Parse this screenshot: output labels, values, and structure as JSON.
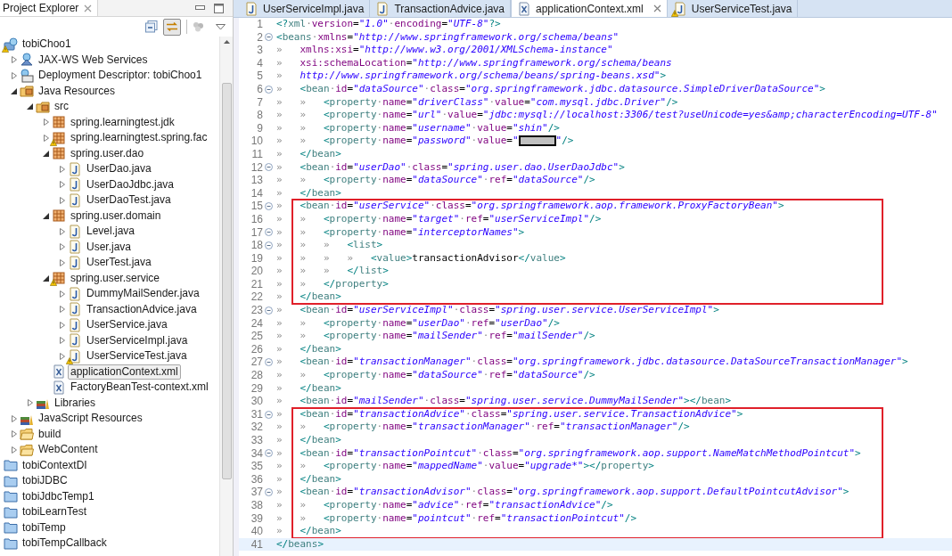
{
  "explorer": {
    "title": "Project Explorer",
    "link_with_editor_on": true,
    "tree": [
      {
        "label": "tobiChoo1",
        "kind": "project",
        "arrow": false,
        "expanded": true,
        "warning": true,
        "selected": false,
        "children": [
          {
            "label": "JAX-WS Web Services",
            "kind": "webservices",
            "arrow": true,
            "expanded": false,
            "warning": false,
            "selected": false
          },
          {
            "label": "Deployment Descriptor: tobiChoo1",
            "kind": "descriptor",
            "arrow": true,
            "expanded": false,
            "warning": false,
            "selected": false
          },
          {
            "label": "Java Resources",
            "kind": "java-resources",
            "arrow": true,
            "expanded": true,
            "warning": false,
            "selected": false,
            "children": [
              {
                "label": "src",
                "kind": "source-folder",
                "arrow": true,
                "expanded": true,
                "warning": false,
                "selected": false,
                "children": [
                  {
                    "label": "spring.learningtest.jdk",
                    "kind": "package",
                    "arrow": true,
                    "expanded": false,
                    "warning": false,
                    "selected": false
                  },
                  {
                    "label": "spring.learningtest.spring.fac",
                    "kind": "package",
                    "arrow": true,
                    "expanded": false,
                    "warning": true,
                    "selected": false
                  },
                  {
                    "label": "spring.user.dao",
                    "kind": "package",
                    "arrow": true,
                    "expanded": true,
                    "warning": false,
                    "selected": false,
                    "children": [
                      {
                        "label": "UserDao.java",
                        "kind": "java-file",
                        "arrow": true,
                        "expanded": false,
                        "warning": false,
                        "selected": false
                      },
                      {
                        "label": "UserDaoJdbc.java",
                        "kind": "java-file",
                        "arrow": true,
                        "expanded": false,
                        "warning": false,
                        "selected": false
                      },
                      {
                        "label": "UserDaoTest.java",
                        "kind": "java-file",
                        "arrow": true,
                        "expanded": false,
                        "warning": false,
                        "selected": false
                      }
                    ]
                  },
                  {
                    "label": "spring.user.domain",
                    "kind": "package",
                    "arrow": true,
                    "expanded": true,
                    "warning": false,
                    "selected": false,
                    "children": [
                      {
                        "label": "Level.java",
                        "kind": "java-file",
                        "arrow": true,
                        "expanded": false,
                        "warning": false,
                        "selected": false
                      },
                      {
                        "label": "User.java",
                        "kind": "java-file",
                        "arrow": true,
                        "expanded": false,
                        "warning": false,
                        "selected": false
                      },
                      {
                        "label": "UserTest.java",
                        "kind": "java-file",
                        "arrow": true,
                        "expanded": false,
                        "warning": false,
                        "selected": false
                      }
                    ]
                  },
                  {
                    "label": "spring.user.service",
                    "kind": "package",
                    "arrow": true,
                    "expanded": true,
                    "warning": true,
                    "selected": false,
                    "children": [
                      {
                        "label": "DummyMailSender.java",
                        "kind": "java-file",
                        "arrow": true,
                        "expanded": false,
                        "warning": false,
                        "selected": false
                      },
                      {
                        "label": "TransactionAdvice.java",
                        "kind": "java-file",
                        "arrow": true,
                        "expanded": false,
                        "warning": false,
                        "selected": false
                      },
                      {
                        "label": "UserService.java",
                        "kind": "java-file",
                        "arrow": true,
                        "expanded": false,
                        "warning": false,
                        "selected": false
                      },
                      {
                        "label": "UserServiceImpl.java",
                        "kind": "java-file",
                        "arrow": true,
                        "expanded": false,
                        "warning": false,
                        "selected": false
                      },
                      {
                        "label": "UserServiceTest.java",
                        "kind": "java-file",
                        "arrow": true,
                        "expanded": false,
                        "warning": true,
                        "selected": false
                      }
                    ]
                  },
                  {
                    "label": "applicationContext.xml",
                    "kind": "xml-file",
                    "arrow": false,
                    "expanded": false,
                    "warning": false,
                    "selected": true
                  },
                  {
                    "label": "FactoryBeanTest-context.xml",
                    "kind": "xml-file",
                    "arrow": false,
                    "expanded": false,
                    "warning": false,
                    "selected": false
                  }
                ]
              },
              {
                "label": "Libraries",
                "kind": "libraries",
                "arrow": true,
                "expanded": false,
                "warning": false,
                "selected": false
              }
            ]
          },
          {
            "label": "JavaScript Resources",
            "kind": "libraries",
            "arrow": true,
            "expanded": false,
            "warning": false,
            "selected": false
          },
          {
            "label": "build",
            "kind": "folder",
            "arrow": true,
            "expanded": false,
            "warning": false,
            "selected": false
          },
          {
            "label": "WebContent",
            "kind": "folder",
            "arrow": true,
            "expanded": false,
            "warning": false,
            "selected": false
          }
        ]
      },
      {
        "label": "tobiContextDI",
        "kind": "closed-project",
        "arrow": false,
        "expanded": false,
        "warning": false,
        "selected": false
      },
      {
        "label": "tobiJDBC",
        "kind": "closed-project",
        "arrow": false,
        "expanded": false,
        "warning": false,
        "selected": false
      },
      {
        "label": "tobiJdbcTemp1",
        "kind": "closed-project",
        "arrow": false,
        "expanded": false,
        "warning": false,
        "selected": false
      },
      {
        "label": "tobiLearnTest",
        "kind": "closed-project",
        "arrow": false,
        "expanded": false,
        "warning": false,
        "selected": false
      },
      {
        "label": "tobiTemp",
        "kind": "closed-project",
        "arrow": false,
        "expanded": false,
        "warning": false,
        "selected": false
      },
      {
        "label": "tobiTempCallback",
        "kind": "closed-project",
        "arrow": false,
        "expanded": false,
        "warning": false,
        "selected": false
      }
    ]
  },
  "editor": {
    "tabs": [
      {
        "label": "UserServiceImpl.java",
        "kind": "java",
        "selected": false,
        "warning": false
      },
      {
        "label": "TransactionAdvice.java",
        "kind": "java",
        "selected": false,
        "warning": false
      },
      {
        "label": "applicationContext.xml",
        "kind": "xml",
        "selected": true,
        "warning": false
      },
      {
        "label": "UserServiceTest.java",
        "kind": "java",
        "selected": false,
        "warning": true
      }
    ],
    "blocks": [
      {
        "boxed": false,
        "lines": [
          {
            "number": "1",
            "fold": false,
            "current": false,
            "text": "<?xml·version=\"1.0\"·encoding=\"UTF-8\"?>"
          },
          {
            "number": "2",
            "fold": true,
            "current": false,
            "text": "<beans·xmlns=\"http://www.springframework.org/schema/beans\""
          },
          {
            "number": "3",
            "fold": false,
            "current": false,
            "text": "»   xmlns:xsi=\"http://www.w3.org/2001/XMLSchema-instance\""
          },
          {
            "number": "4",
            "fold": false,
            "current": false,
            "text": "»   xsi:schemaLocation=\"http://www.springframework.org/schema/beans"
          },
          {
            "number": "5",
            "fold": false,
            "current": false,
            "text": "»   http://www.springframework.org/schema/beans/spring-beans.xsd\">"
          },
          {
            "number": "6",
            "fold": true,
            "current": false,
            "text": "»   <bean·id=\"dataSource\"·class=\"org.springframework.jdbc.datasource.SimpleDriverDataSource\">"
          },
          {
            "number": "7",
            "fold": false,
            "current": false,
            "text": "»   »   <property·name=\"driverClass\"·value=\"com.mysql.jdbc.Driver\"/>"
          },
          {
            "number": "8",
            "fold": false,
            "current": false,
            "text": "»   »   <property·name=\"url\"·value=\"jdbc:mysql://localhost:3306/test?useUnicode=yes&amp;characterEncoding=UTF-8\""
          },
          {
            "number": "9",
            "fold": false,
            "current": false,
            "text": "»   »   <property·name=\"username\"·value=\"shin\"/>"
          },
          {
            "number": "10",
            "fold": false,
            "current": false,
            "text": "»   »   <property·name=\"password\"·value=\"",
            "redacted": true,
            "after": "\"/>"
          },
          {
            "number": "11",
            "fold": false,
            "current": false,
            "text": "»   </bean>"
          },
          {
            "number": "12",
            "fold": true,
            "current": false,
            "text": "»   <bean·id=\"userDao\"·class=\"spring.user.dao.UserDaoJdbc\">"
          },
          {
            "number": "13",
            "fold": false,
            "current": false,
            "text": "»   »   <property·name=\"dataSource\"·ref=\"dataSource\"/>"
          },
          {
            "number": "14",
            "fold": false,
            "current": false,
            "text": "»   </bean>"
          }
        ]
      },
      {
        "boxed": true,
        "lines": [
          {
            "number": "15",
            "fold": true,
            "current": false,
            "text": "»   <bean·id=\"userService\"·class=\"org.springframework.aop.framework.ProxyFactoryBean\">"
          },
          {
            "number": "16",
            "fold": false,
            "current": false,
            "text": "»   »   <property·name=\"target\"·ref=\"userServiceImpl\"/>"
          },
          {
            "number": "17",
            "fold": true,
            "current": false,
            "text": "»   »   <property·name=\"interceptorNames\">"
          },
          {
            "number": "18",
            "fold": true,
            "current": false,
            "text": "»   »   »   <list>"
          },
          {
            "number": "19",
            "fold": false,
            "current": false,
            "text": "»   »   »   »   <value>transactionAdvisor</value>"
          },
          {
            "number": "20",
            "fold": false,
            "current": false,
            "text": "»   »   »   </list>"
          },
          {
            "number": "21",
            "fold": false,
            "current": false,
            "text": "»   »   </property>"
          },
          {
            "number": "22",
            "fold": false,
            "current": false,
            "text": "»   </bean>"
          }
        ]
      },
      {
        "boxed": false,
        "lines": [
          {
            "number": "23",
            "fold": true,
            "current": false,
            "text": "»   <bean·id=\"userServiceImpl\"·class=\"spring.user.service.UserServiceImpl\">"
          },
          {
            "number": "24",
            "fold": false,
            "current": false,
            "text": "»   »   <property·name=\"userDao\"·ref=\"userDao\"/>"
          },
          {
            "number": "25",
            "fold": false,
            "current": false,
            "text": "»   »   <property·name=\"mailSender\"·ref=\"mailSender\"/>"
          },
          {
            "number": "26",
            "fold": false,
            "current": false,
            "text": "»   </bean>"
          },
          {
            "number": "27",
            "fold": true,
            "current": false,
            "text": "»   <bean·id=\"transactionManager\"·class=\"org.springframework.jdbc.datasource.DataSourceTransactionManager\">"
          },
          {
            "number": "28",
            "fold": false,
            "current": false,
            "text": "»   »   <property·name=\"dataSource\"·ref=\"dataSource\"/>"
          },
          {
            "number": "29",
            "fold": false,
            "current": false,
            "text": "»   </bean>"
          },
          {
            "number": "30",
            "fold": false,
            "current": false,
            "text": "»   <bean·id=\"mailSender\"·class=\"spring.user.service.DummyMailSender\"></bean>"
          }
        ]
      },
      {
        "boxed": true,
        "lines": [
          {
            "number": "31",
            "fold": true,
            "current": false,
            "text": "»   <bean·id=\"transactionAdvice\"·class=\"spring.user.service.TransactionAdvice\">"
          },
          {
            "number": "32",
            "fold": false,
            "current": false,
            "text": "»   »   <property·name=\"transactionManager\"·ref=\"transactionManager\"/>"
          },
          {
            "number": "33",
            "fold": false,
            "current": false,
            "text": "»   </bean>"
          },
          {
            "number": "34",
            "fold": true,
            "current": false,
            "text": "»   <bean·id=\"transactionPointcut\"·class=\"org.springframework.aop.support.NameMatchMethodPointcut\">"
          },
          {
            "number": "35",
            "fold": false,
            "current": false,
            "text": "»   »   <property·name=\"mappedName\"·value=\"upgrade*\"></property>"
          },
          {
            "number": "36",
            "fold": false,
            "current": false,
            "text": "»   </bean>"
          },
          {
            "number": "37",
            "fold": true,
            "current": false,
            "text": "»   <bean·id=\"transactionAdvisor\"·class=\"org.springframework.aop.support.DefaultPointcutAdvisor\">"
          },
          {
            "number": "38",
            "fold": false,
            "current": false,
            "text": "»   »   <property·name=\"advice\"·ref=\"transactionAdvice\"/>"
          },
          {
            "number": "39",
            "fold": false,
            "current": false,
            "text": "»   »   <property·name=\"pointcut\"·ref=\"transactionPointcut\"/>"
          },
          {
            "number": "40",
            "fold": false,
            "current": false,
            "text": "»   </bean>"
          }
        ]
      },
      {
        "boxed": false,
        "lines": [
          {
            "number": "41",
            "fold": false,
            "current": true,
            "text": "</beans>"
          }
        ]
      }
    ]
  }
}
